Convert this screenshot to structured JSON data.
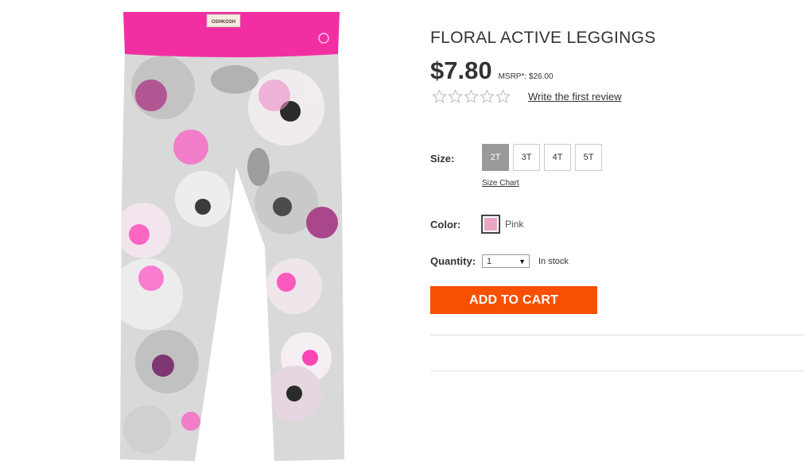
{
  "product": {
    "title": "FLORAL ACTIVE LEGGINGS",
    "price": "$7.80",
    "msrp": "MSRP*: $26.00",
    "brand_tag": "OSHKOSH",
    "rating_stars": 0,
    "review_link": "Write the first review"
  },
  "size": {
    "label": "Size:",
    "options": [
      "2T",
      "3T",
      "4T",
      "5T"
    ],
    "selected": "2T",
    "chart_link": "Size Chart"
  },
  "color": {
    "label": "Color:",
    "name": "Pink",
    "swatch_hex": "#e8a7c4"
  },
  "quantity": {
    "label": "Quantity:",
    "value": "1",
    "stock": "In stock"
  },
  "cart": {
    "button_label": "ADD TO CART",
    "button_color": "#f75000"
  }
}
